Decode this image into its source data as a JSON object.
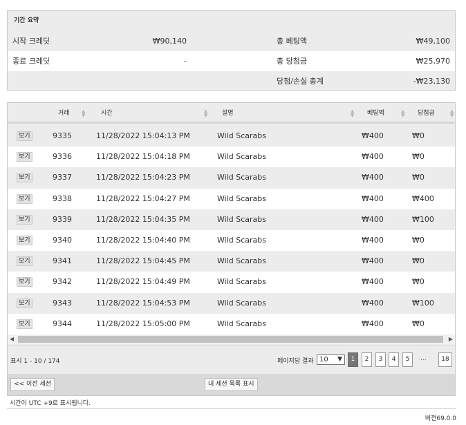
{
  "summary": {
    "title": "기간 요약",
    "start_credit_label": "시작 크레딧",
    "start_credit_value": "₩90,140",
    "end_credit_label": "종료 크레딧",
    "end_credit_value": "-",
    "total_bet_label": "총 베팅액",
    "total_bet_value": "₩49,100",
    "total_win_label": "총 당첨금",
    "total_win_value": "₩25,970",
    "net_label": "당첨/손실 총계",
    "net_value": "-₩23,130"
  },
  "table": {
    "columns": {
      "transaction": "거래",
      "time": "시간",
      "description": "설명",
      "bet": "베팅액",
      "win": "당첨금"
    },
    "view_label": "보기",
    "rows": [
      {
        "id": "9335",
        "time": "11/28/2022 15:04:13 PM",
        "desc": "Wild Scarabs",
        "bet": "₩400",
        "win": "₩0"
      },
      {
        "id": "9336",
        "time": "11/28/2022 15:04:18 PM",
        "desc": "Wild Scarabs",
        "bet": "₩400",
        "win": "₩0"
      },
      {
        "id": "9337",
        "time": "11/28/2022 15:04:23 PM",
        "desc": "Wild Scarabs",
        "bet": "₩400",
        "win": "₩0"
      },
      {
        "id": "9338",
        "time": "11/28/2022 15:04:27 PM",
        "desc": "Wild Scarabs",
        "bet": "₩400",
        "win": "₩400"
      },
      {
        "id": "9339",
        "time": "11/28/2022 15:04:35 PM",
        "desc": "Wild Scarabs",
        "bet": "₩400",
        "win": "₩100"
      },
      {
        "id": "9340",
        "time": "11/28/2022 15:04:40 PM",
        "desc": "Wild Scarabs",
        "bet": "₩400",
        "win": "₩0"
      },
      {
        "id": "9341",
        "time": "11/28/2022 15:04:45 PM",
        "desc": "Wild Scarabs",
        "bet": "₩400",
        "win": "₩0"
      },
      {
        "id": "9342",
        "time": "11/28/2022 15:04:49 PM",
        "desc": "Wild Scarabs",
        "bet": "₩400",
        "win": "₩0"
      },
      {
        "id": "9343",
        "time": "11/28/2022 15:04:53 PM",
        "desc": "Wild Scarabs",
        "bet": "₩400",
        "win": "₩100"
      },
      {
        "id": "9344",
        "time": "11/28/2022 15:05:00 PM",
        "desc": "Wild Scarabs",
        "bet": "₩400",
        "win": "₩0"
      }
    ]
  },
  "pager": {
    "count_text": "표시 1 - 10 / 174",
    "per_page_label": "페이지당 결과",
    "per_page_value": "10",
    "pages": [
      "1",
      "2",
      "3",
      "4",
      "5"
    ],
    "active_page": "1",
    "ellipsis": "...",
    "last_page": "18"
  },
  "nav": {
    "prev_session": "<< 이전 세션",
    "my_sessions": "내 세션 목록 표시"
  },
  "footer": {
    "timezone_note": "시간이 UTC +9로 표시됩니다.",
    "version": "버전69.0.0"
  },
  "icons": {
    "scroll_left": "scroll-left-icon",
    "scroll_right": "scroll-right-icon",
    "sort": "sort-icon",
    "dropdown": "chevron-down-icon"
  }
}
